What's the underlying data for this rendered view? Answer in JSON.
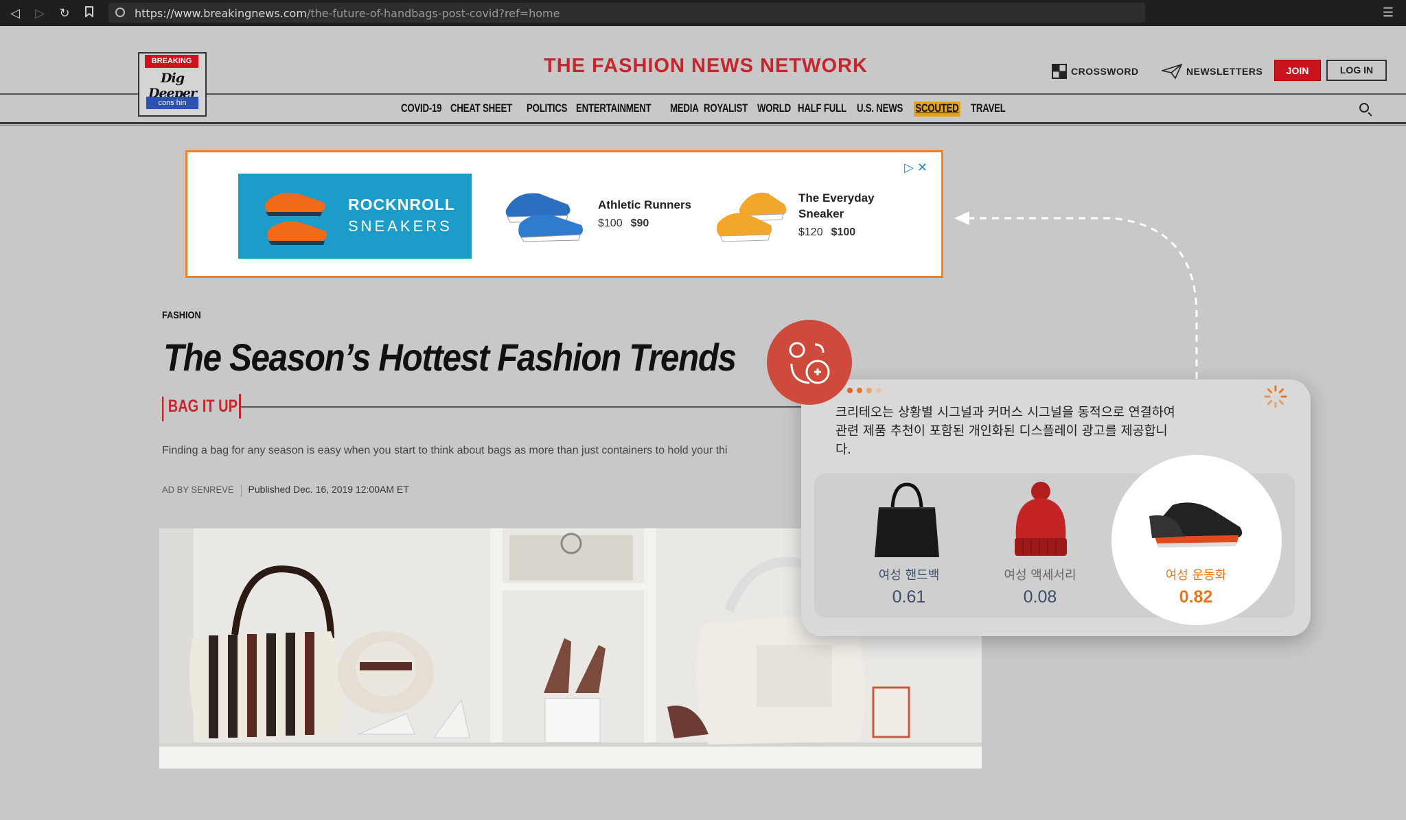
{
  "browser": {
    "url_domain": "https://www.breakingnews.com",
    "url_path": "/the-future-of-handbags-post-covid?ref=home",
    "back_icon": "back-arrow-icon",
    "forward_icon": "forward-arrow-icon",
    "reload_icon": "reload-icon",
    "bookmark_icon": "bookmark-icon",
    "menu_icon": "menu-icon"
  },
  "site": {
    "logo_tag": "BREAKING",
    "logo_name": "Dig Deeper",
    "logo_sub": "cons hin",
    "title": "THE FASHION NEWS NETWORK",
    "crossword": "CROSSWORD",
    "newsletters": "NEWSLETTERS",
    "join": "JOIN",
    "login": "LOG IN",
    "nav": [
      "COVID-19",
      "CHEAT SHEET",
      "POLITICS",
      "ENTERTAINMENT",
      "MEDIA",
      "ROYALIST",
      "WORLD",
      "HALF FULL",
      "U.S. NEWS",
      "SCOUTED",
      "TRAVEL"
    ],
    "brand_red": "#c8242c"
  },
  "ad": {
    "hero_line1": "ROCKNROLL",
    "hero_line2": "SNEAKERS",
    "products": [
      {
        "name": "Athletic Runners",
        "old_price": "$100",
        "price": "$90"
      },
      {
        "name_line1": "The Everyday",
        "name_line2": "Sneaker",
        "old_price": "$120",
        "price": "$100"
      }
    ],
    "border_color": "#f0802a"
  },
  "article": {
    "kicker": "FASHION",
    "headline": "The Season’s Hottest Fashion Trends",
    "section_tag": "BAG IT UP",
    "dek": "Finding a bag for any season is easy when you start to think about bags as more than just containers to hold your thi",
    "ad_by": "AD BY SENREVE",
    "published": "Published Dec. 16, 2019 12:00AM ET"
  },
  "overlay": {
    "description": "크리테오는 상황별 시그널과 커머스 시그널을 동적으로 연결하여 관련 제품 추천이 포함된 개인화된 디스플레이 광고를 제공합니다.",
    "categories": [
      {
        "label": "여성 핸드백",
        "score": "0.61"
      },
      {
        "label": "여성 액세서리",
        "score": "0.08"
      },
      {
        "label": "여성 운동화",
        "score": "0.82"
      }
    ],
    "accent": "#e8761e",
    "score_color": "#3c4f6a"
  }
}
